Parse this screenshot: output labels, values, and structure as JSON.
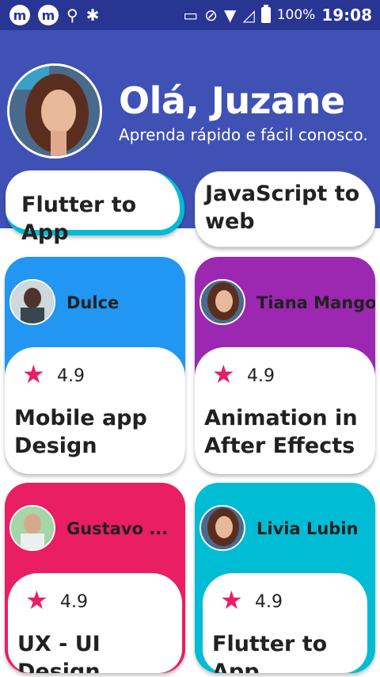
{
  "status_bar": {
    "left_icons": [
      "m-app-icon",
      "m-app-icon",
      "usb-icon",
      "android-debug-icon"
    ],
    "battery_percent": "100%",
    "time": "19:08"
  },
  "header": {
    "greeting": "Olá, Juzane",
    "subtitle": "Aprenda rápido e fácil conosco."
  },
  "pills": [
    {
      "label": "Flutter to App",
      "accent": "#00bcd4"
    },
    {
      "label": "JavaScript to web",
      "accent": "#ffffff"
    }
  ],
  "courses": [
    {
      "author": "Dulce",
      "rating": "4.9",
      "title": "Mobile app Design",
      "color": "#2196f3"
    },
    {
      "author": "Tiana Mango",
      "rating": "4.9",
      "title": "Animation in After Effects",
      "color": "#9c27b0"
    },
    {
      "author": "Gustavo ...",
      "rating": "4.9",
      "title": "UX - UI Design",
      "color": "#e91e63"
    },
    {
      "author": "Livia Lubin",
      "rating": "4.9",
      "title": "Flutter to App",
      "color": "#00bcd4"
    }
  ],
  "colors": {
    "header_bg": "#3f51b5",
    "status_bg": "#283593",
    "star": "#e91e63"
  }
}
